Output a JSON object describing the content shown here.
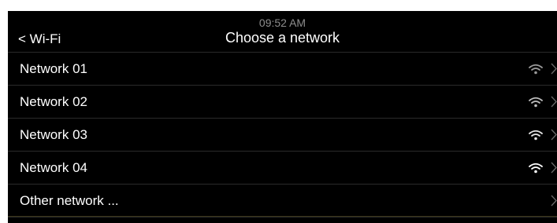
{
  "status": {
    "time": "09:52 AM"
  },
  "header": {
    "back_label": "< Wi-Fi",
    "title": "Choose a network"
  },
  "networks": [
    {
      "name": "Network 01",
      "signal_icon": "wifi-signal-icon",
      "signal_color": "#9a9a9a"
    },
    {
      "name": "Network 02",
      "signal_icon": "wifi-signal-icon",
      "signal_color": "#bdbdbd"
    },
    {
      "name": "Network 03",
      "signal_icon": "wifi-signal-icon",
      "signal_color": "#e6e6e6"
    },
    {
      "name": "Network 04",
      "signal_icon": "wifi-signal-icon",
      "signal_color": "#ffffff"
    }
  ],
  "other": {
    "label": "Other network ..."
  },
  "colors": {
    "background": "#000000",
    "divider": "#2a2a2a",
    "chevron": "#6a6a6a",
    "time": "#8d8d8d"
  }
}
